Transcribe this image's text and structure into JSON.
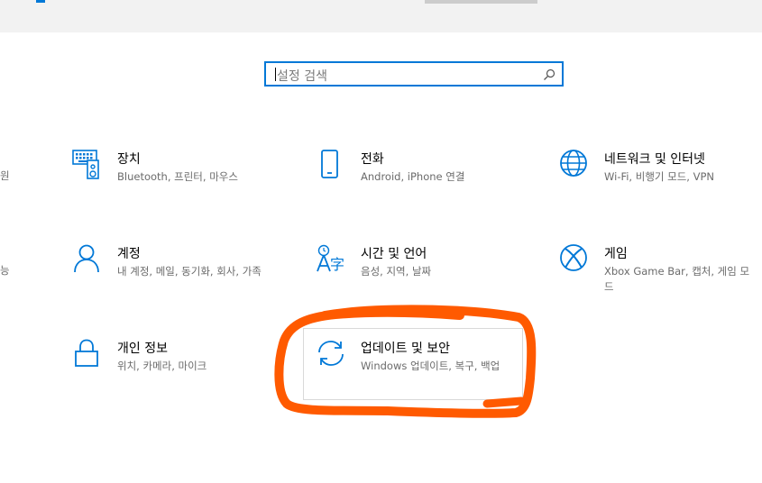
{
  "search": {
    "placeholder": "설정 검색"
  },
  "tiles": [
    {
      "title": "장치",
      "desc": "Bluetooth, 프린터, 마우스",
      "icon": "devices-icon"
    },
    {
      "title": "전화",
      "desc": "Android, iPhone 연결",
      "icon": "phone-icon"
    },
    {
      "title": "네트워크 및 인터넷",
      "desc": "Wi-Fi, 비행기 모드, VPN",
      "icon": "globe-icon"
    },
    {
      "title": "계정",
      "desc": "내 계정, 메일, 동기화, 회사, 가족",
      "icon": "person-icon"
    },
    {
      "title": "시간 및 언어",
      "desc": "음성, 지역, 날짜",
      "icon": "time-language-icon"
    },
    {
      "title": "게임",
      "desc": "Xbox Game Bar, 캡처, 게임 모드",
      "icon": "xbox-icon"
    },
    {
      "title": "개인 정보",
      "desc": "위치, 카메라, 마이크",
      "icon": "lock-icon"
    },
    {
      "title": "업데이트 및 보안",
      "desc": "Windows 업데이트, 복구, 백업",
      "icon": "sync-icon"
    }
  ],
  "partials": [
    "원",
    "능"
  ],
  "colors": {
    "accent": "#0078d7",
    "annotation": "#ff5a00"
  }
}
